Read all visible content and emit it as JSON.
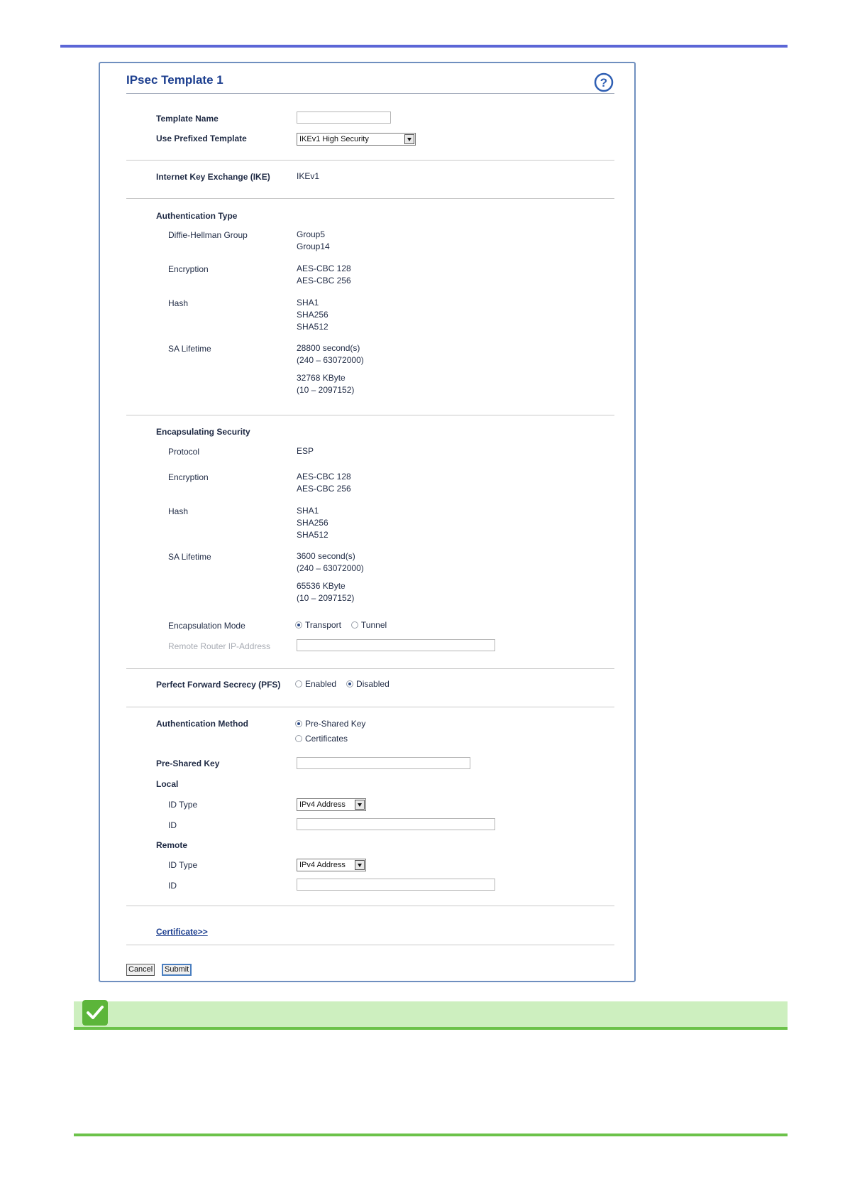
{
  "colors": {
    "top_rule": "#5b66d6",
    "note_bar": "#cdefbf",
    "note_line": "#6cc24a",
    "check_bg": "#5cb53a"
  },
  "header": {
    "title": "IPsec Template 1",
    "help_icon": "help-icon"
  },
  "fields": {
    "template_name_label": "Template Name",
    "template_name_value": "",
    "prefixed_label": "Use Prefixed Template",
    "prefixed_value": "IKEv1 High Security",
    "ike_label": "Internet Key Exchange (IKE)",
    "ike_value": "IKEv1"
  },
  "auth_type": {
    "heading": "Authentication Type",
    "dh_label": "Diffie-Hellman Group",
    "dh_values": [
      "Group5",
      "Group14"
    ],
    "enc_label": "Encryption",
    "enc_values": [
      "AES-CBC 128",
      "AES-CBC 256"
    ],
    "hash_label": "Hash",
    "hash_values": [
      "SHA1",
      "SHA256",
      "SHA512"
    ],
    "sa_label": "SA Lifetime",
    "sa_time": [
      "28800 second(s)",
      "(240 – 63072000)"
    ],
    "sa_size": [
      "32768 KByte",
      "(10 – 2097152)"
    ]
  },
  "encap": {
    "heading": "Encapsulating Security",
    "protocol_label": "Protocol",
    "protocol_value": "ESP",
    "enc_label": "Encryption",
    "enc_values": [
      "AES-CBC 128",
      "AES-CBC 256"
    ],
    "hash_label": "Hash",
    "hash_values": [
      "SHA1",
      "SHA256",
      "SHA512"
    ],
    "sa_label": "SA Lifetime",
    "sa_time": [
      "3600 second(s)",
      "(240 – 63072000)"
    ],
    "sa_size": [
      "65536 KByte",
      "(10 – 2097152)"
    ],
    "mode_label": "Encapsulation Mode",
    "mode_options": [
      "Transport",
      "Tunnel"
    ],
    "mode_selected": "Transport",
    "remote_router_label": "Remote Router IP-Address",
    "remote_router_value": ""
  },
  "pfs": {
    "label": "Perfect Forward Secrecy (PFS)",
    "options": [
      "Enabled",
      "Disabled"
    ],
    "selected": "Disabled"
  },
  "auth_method": {
    "label": "Authentication Method",
    "options": [
      "Pre-Shared Key",
      "Certificates"
    ],
    "selected": "Pre-Shared Key",
    "psk_label": "Pre-Shared Key",
    "psk_value": ""
  },
  "local": {
    "heading": "Local",
    "id_type_label": "ID Type",
    "id_type_value": "IPv4 Address",
    "id_label": "ID",
    "id_value": ""
  },
  "remote": {
    "heading": "Remote",
    "id_type_label": "ID Type",
    "id_type_value": "IPv4 Address",
    "id_label": "ID",
    "id_value": ""
  },
  "footer": {
    "certificate_link": "Certificate>>",
    "cancel_label": "Cancel",
    "submit_label": "Submit"
  }
}
